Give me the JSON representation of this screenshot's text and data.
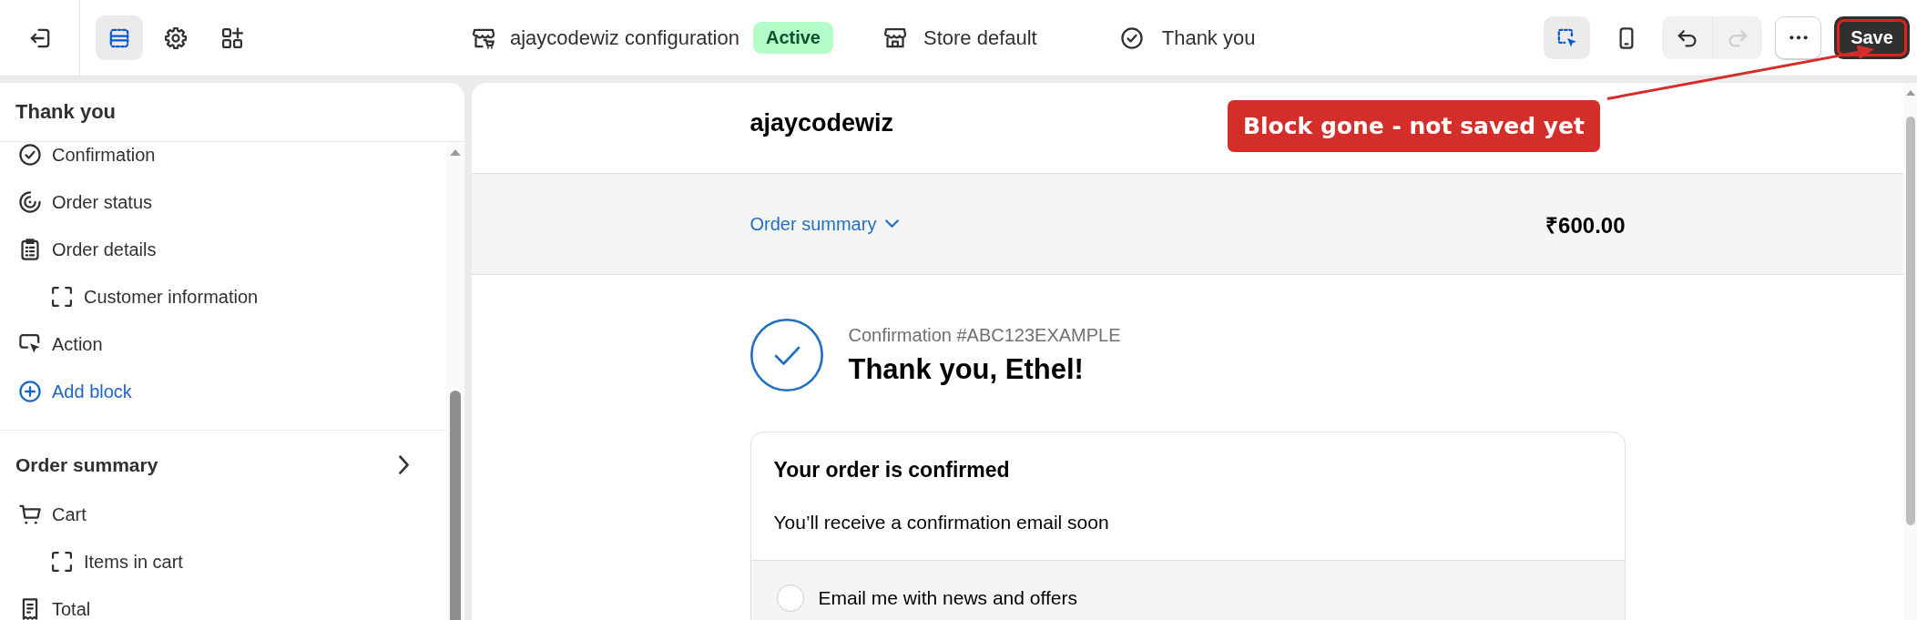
{
  "top_bar": {
    "tools": [
      {
        "selected": true
      },
      {
        "selected": false
      },
      {
        "selected": false
      }
    ],
    "config": {
      "name": "ajaycodewiz configuration",
      "status": "Active"
    },
    "store": "Store default",
    "page": "Thank you",
    "preview_tools": [
      {
        "selected": true
      },
      {
        "selected": false
      }
    ],
    "history": [
      {
        "disabled": false
      },
      {
        "disabled": true
      }
    ],
    "save": "Save"
  },
  "sidebar": {
    "title": "Thank you",
    "items": [
      {
        "label": "Confirmation"
      },
      {
        "label": "Order status"
      },
      {
        "label": "Order details",
        "children": [
          {
            "label": "Customer information"
          }
        ]
      },
      {
        "label": "Action"
      }
    ],
    "add_block": "Add block",
    "sections": [
      {
        "title": "Order summary",
        "items": [
          {
            "label": "Cart",
            "children": [
              {
                "label": "Items in cart"
              }
            ]
          },
          {
            "label": "Total"
          }
        ]
      }
    ]
  },
  "preview": {
    "shop_name": "ajaycodewiz",
    "summary_toggle": "Order summary",
    "total": "₹600.00",
    "confirmation_number": "Confirmation #ABC123EXAMPLE",
    "greeting": "Thank you, Ethel!",
    "status_card": {
      "title": "Your order is confirmed",
      "message": "You’ll receive a confirmation email soon",
      "opt_in": {
        "label": "Email me with news and offers",
        "checked": false
      }
    }
  },
  "annotation": {
    "text": "Block gone - not saved yet"
  }
}
